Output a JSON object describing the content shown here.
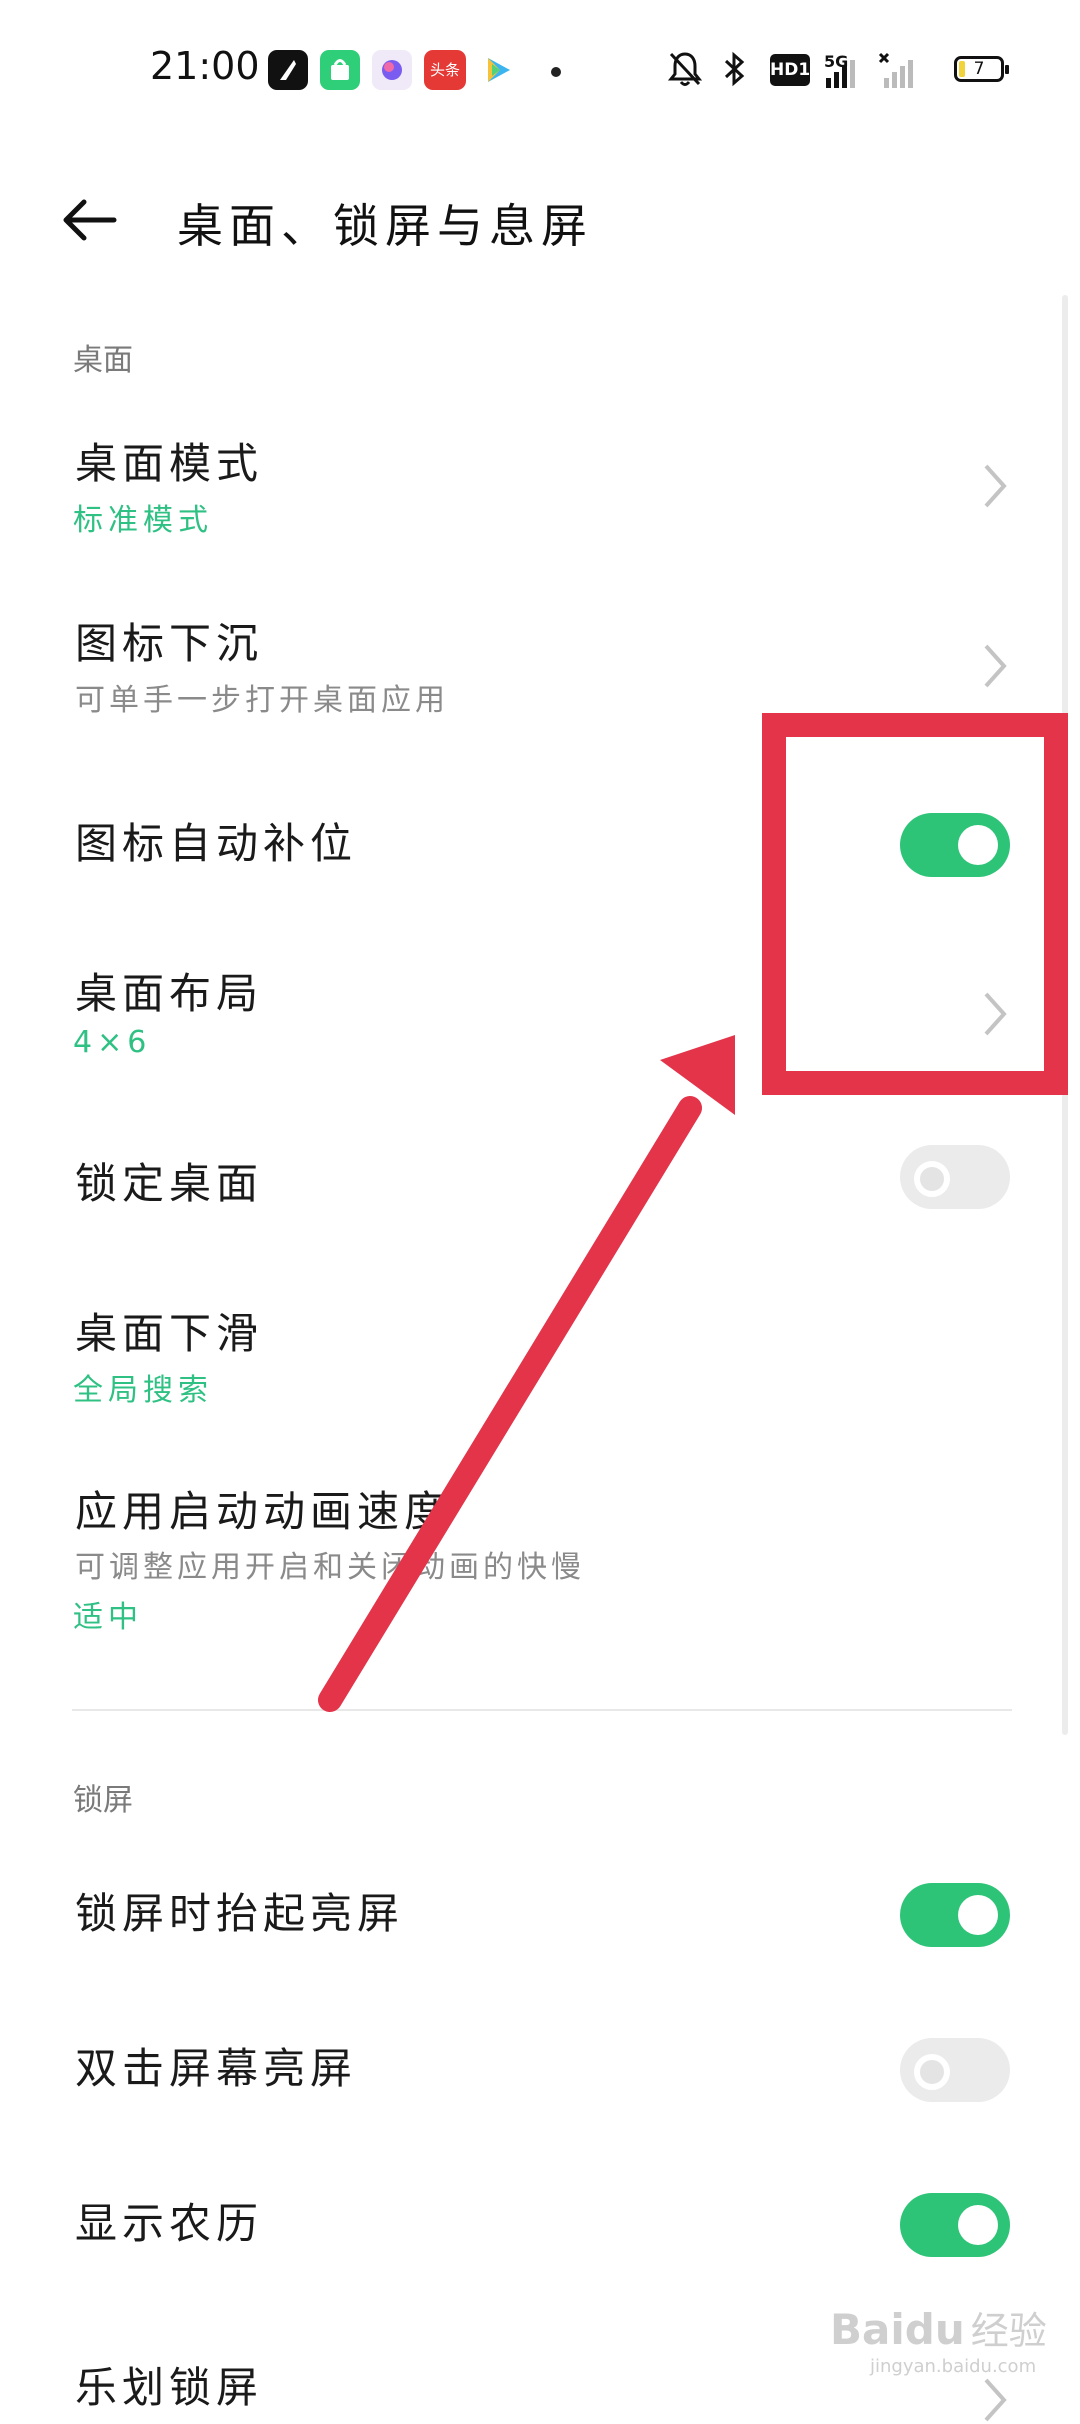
{
  "status_bar": {
    "time": "21:00",
    "notification_badge": "头条",
    "hd_label": "HD1",
    "network_label": "5G",
    "battery_level": "7",
    "icons": [
      "feather-app-icon",
      "shopping-bag-app-icon",
      "browser-app-icon",
      "toutiao-app-icon",
      "video-app-icon",
      "more-dot-icon",
      "bell-off-icon",
      "bluetooth-icon",
      "hd-voice-icon",
      "signal-5g-icon",
      "signal-empty-icon",
      "battery-icon"
    ]
  },
  "appbar": {
    "title": "桌面、锁屏与息屏",
    "back_icon": "arrow-left-icon"
  },
  "sections": {
    "desktop": {
      "header": "桌面",
      "items": [
        {
          "title": "桌面模式",
          "value": "标准模式",
          "control": "chevron"
        },
        {
          "title": "图标下沉",
          "subtitle": "可单手一步打开桌面应用",
          "control": "chevron"
        },
        {
          "title": "图标自动补位",
          "control": "toggle",
          "on": true
        },
        {
          "title": "桌面布局",
          "value": "4×6",
          "control": "chevron"
        },
        {
          "title": "锁定桌面",
          "control": "toggle",
          "on": false
        },
        {
          "title": "桌面下滑",
          "value": "全局搜索",
          "control": "none"
        },
        {
          "title": "应用启动动画速度",
          "subtitle": "可调整应用开启和关闭动画的快慢",
          "value": "适中",
          "control": "none"
        }
      ]
    },
    "lockscreen": {
      "header": "锁屏",
      "items": [
        {
          "title": "锁屏时抬起亮屏",
          "control": "toggle",
          "on": true
        },
        {
          "title": "双击屏幕亮屏",
          "control": "toggle",
          "on": false
        },
        {
          "title": "显示农历",
          "control": "toggle",
          "on": true
        },
        {
          "title": "乐划锁屏",
          "control": "chevron"
        }
      ]
    }
  },
  "annotation": {
    "color": "#e3344a",
    "shapes": [
      "highlight-rectangle",
      "pointer-arrow"
    ]
  },
  "watermark": {
    "main": "Baidu",
    "cn": "经验",
    "sub": "jingyan.baidu.com"
  },
  "colors": {
    "accent_green": "#2dc477",
    "value_green": "#2fc083",
    "annotation_red": "#e3344a"
  }
}
